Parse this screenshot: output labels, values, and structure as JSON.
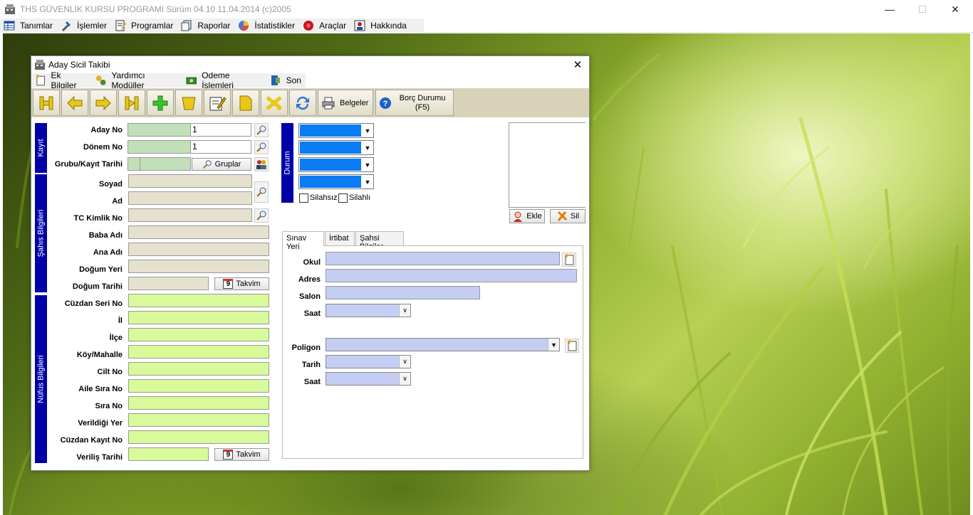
{
  "app": {
    "title": "THS GÜVENLİK KURSU PROGRAMI Sürüm 04.10 11.04.2014 (c)2005",
    "window_controls": {
      "minimize": "—",
      "maximize": "☐",
      "close": "✕"
    }
  },
  "main_menu": [
    {
      "label": "Tanımlar",
      "icon": "table-icon"
    },
    {
      "label": "İşlemler",
      "icon": "tools-icon"
    },
    {
      "label": "Programlar",
      "icon": "notepad-icon"
    },
    {
      "label": "Raporlar",
      "icon": "report-icon"
    },
    {
      "label": "İstatistikler",
      "icon": "chart-icon"
    },
    {
      "label": "Araçlar",
      "icon": "toolbox-icon"
    },
    {
      "label": "Hakkında",
      "icon": "about-icon"
    }
  ],
  "dialog": {
    "title": "Aday Sicil Takibi",
    "close": "✕",
    "menu": [
      {
        "label": "Ek Bilgiler",
        "icon": "new-doc-icon"
      },
      {
        "label": "Yardımcı Modüller",
        "icon": "modules-icon"
      },
      {
        "label": "Odeme İşlemleri",
        "icon": "money-icon"
      },
      {
        "label": "Son",
        "icon": "exit-door-icon"
      }
    ],
    "toolbar": {
      "belgeler": "Belgeler",
      "borc_line1": "Borç Durumu",
      "borc_line2": "(F5)"
    },
    "sections": {
      "kayit": "Kayıt",
      "sahis": "Şahıs Bilgileri",
      "nufus": "Nüfus Bilgileri",
      "durum": "Durum"
    },
    "kayit": {
      "aday_no_label": "Aday No",
      "aday_no_value": "1",
      "donem_no_label": "Dönem No",
      "donem_no_value": "1",
      "grubu_label": "Grubu/Kayıt Tarihi",
      "gruplar_button": "Gruplar"
    },
    "sahis": {
      "soyad": "Soyad",
      "ad": "Ad",
      "tc": "TC Kimlik No",
      "baba": "Baba Adı",
      "ana": "Ana Adı",
      "dogum_yeri": "Doğum Yeri",
      "dogum_tarihi": "Doğum Tarihi",
      "takvim": "Takvim"
    },
    "nufus": {
      "cuzdan_seri": "Cüzdan Seri No",
      "il": "İl",
      "ilce": "İlçe",
      "koy": "Köy/Mahalle",
      "cilt": "Cilt No",
      "aile_sira": "Aile Sıra No",
      "sira": "Sıra No",
      "verildigi_yer": "Verildiği Yer",
      "cuzdan_kayit": "Cüzdan Kayıt No",
      "verilis_tarihi": "Veriliş Tarihi",
      "takvim": "Takvim"
    },
    "durum": {
      "silahsiz": "Silahsız",
      "silahli": "Silahlı",
      "silahsiz_checked": false,
      "silahli_checked": false
    },
    "photo": {
      "ekle": "Ekle",
      "sil": "Sil"
    },
    "tabs": [
      {
        "label": "Sınav Yeri",
        "active": true
      },
      {
        "label": "İrtibat",
        "active": false
      },
      {
        "label": "Şahsi Bilgiler",
        "active": false
      }
    ],
    "sinav": {
      "okul": "Okul",
      "adres": "Adres",
      "salon": "Salon",
      "saat": "Saat",
      "poligon": "Poligon",
      "tarih": "Tarih",
      "saat2": "Saat"
    }
  },
  "colors": {
    "band": "#0000a8",
    "green_field": "#c2dfba",
    "lime_field": "#d9fa9a",
    "beige_field": "#e6e1cf",
    "blue_field": "#c5cdf3",
    "durum_fill": "#0a7cf4",
    "toolbar_bg": "#d8d3b8"
  }
}
